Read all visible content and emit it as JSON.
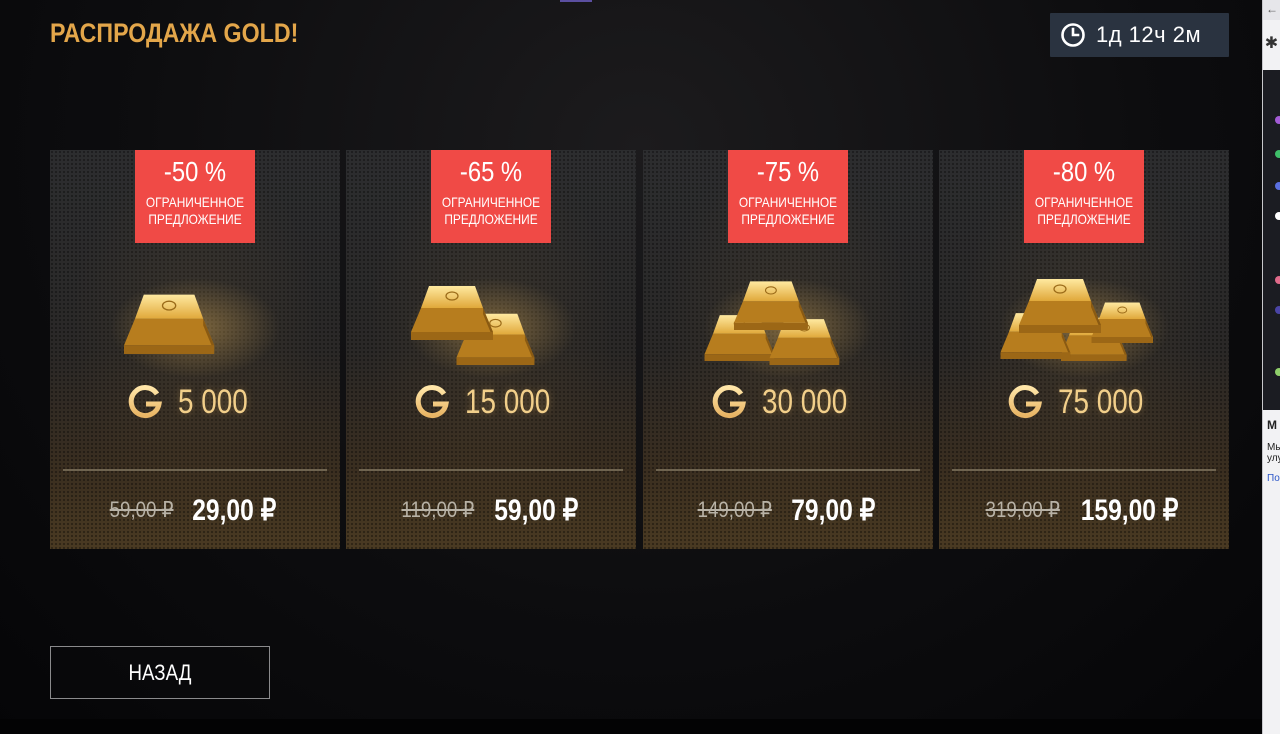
{
  "header": {
    "title": "РАСПРОДАЖА GOLD!",
    "timer": "1д 12ч 2м",
    "timer_icon": "clock-icon"
  },
  "cards": [
    {
      "discount": "-50 %",
      "label": "ОГРАНИЧЕННОЕ ПРЕДЛОЖЕНИЕ",
      "amount": "5 000",
      "old_price": "59,00 ₽",
      "new_price": "29,00 ₽",
      "bars": 1
    },
    {
      "discount": "-65 %",
      "label": "ОГРАНИЧЕННОЕ ПРЕДЛОЖЕНИЕ",
      "amount": "15 000",
      "old_price": "119,00 ₽",
      "new_price": "59,00 ₽",
      "bars": 2
    },
    {
      "discount": "-75 %",
      "label": "ОГРАНИЧЕННОЕ ПРЕДЛОЖЕНИЕ",
      "amount": "30 000",
      "old_price": "149,00 ₽",
      "new_price": "79,00 ₽",
      "bars": 3
    },
    {
      "discount": "-80 %",
      "label": "ОГРАНИЧЕННОЕ ПРЕДЛОЖЕНИЕ",
      "amount": "75 000",
      "old_price": "319,00 ₽",
      "new_price": "159,00 ₽",
      "bars": 4
    }
  ],
  "footer": {
    "back_label": "НАЗАД"
  },
  "side_panel": {
    "arrow": "←",
    "text_1": "М",
    "text_2": "Мы",
    "text_3": "улу",
    "text_4": "По"
  },
  "colors": {
    "title": "#e3a64a",
    "badge": "#f04a46",
    "amount": "#f2cf8a",
    "timer_bg": "#2a3340"
  }
}
